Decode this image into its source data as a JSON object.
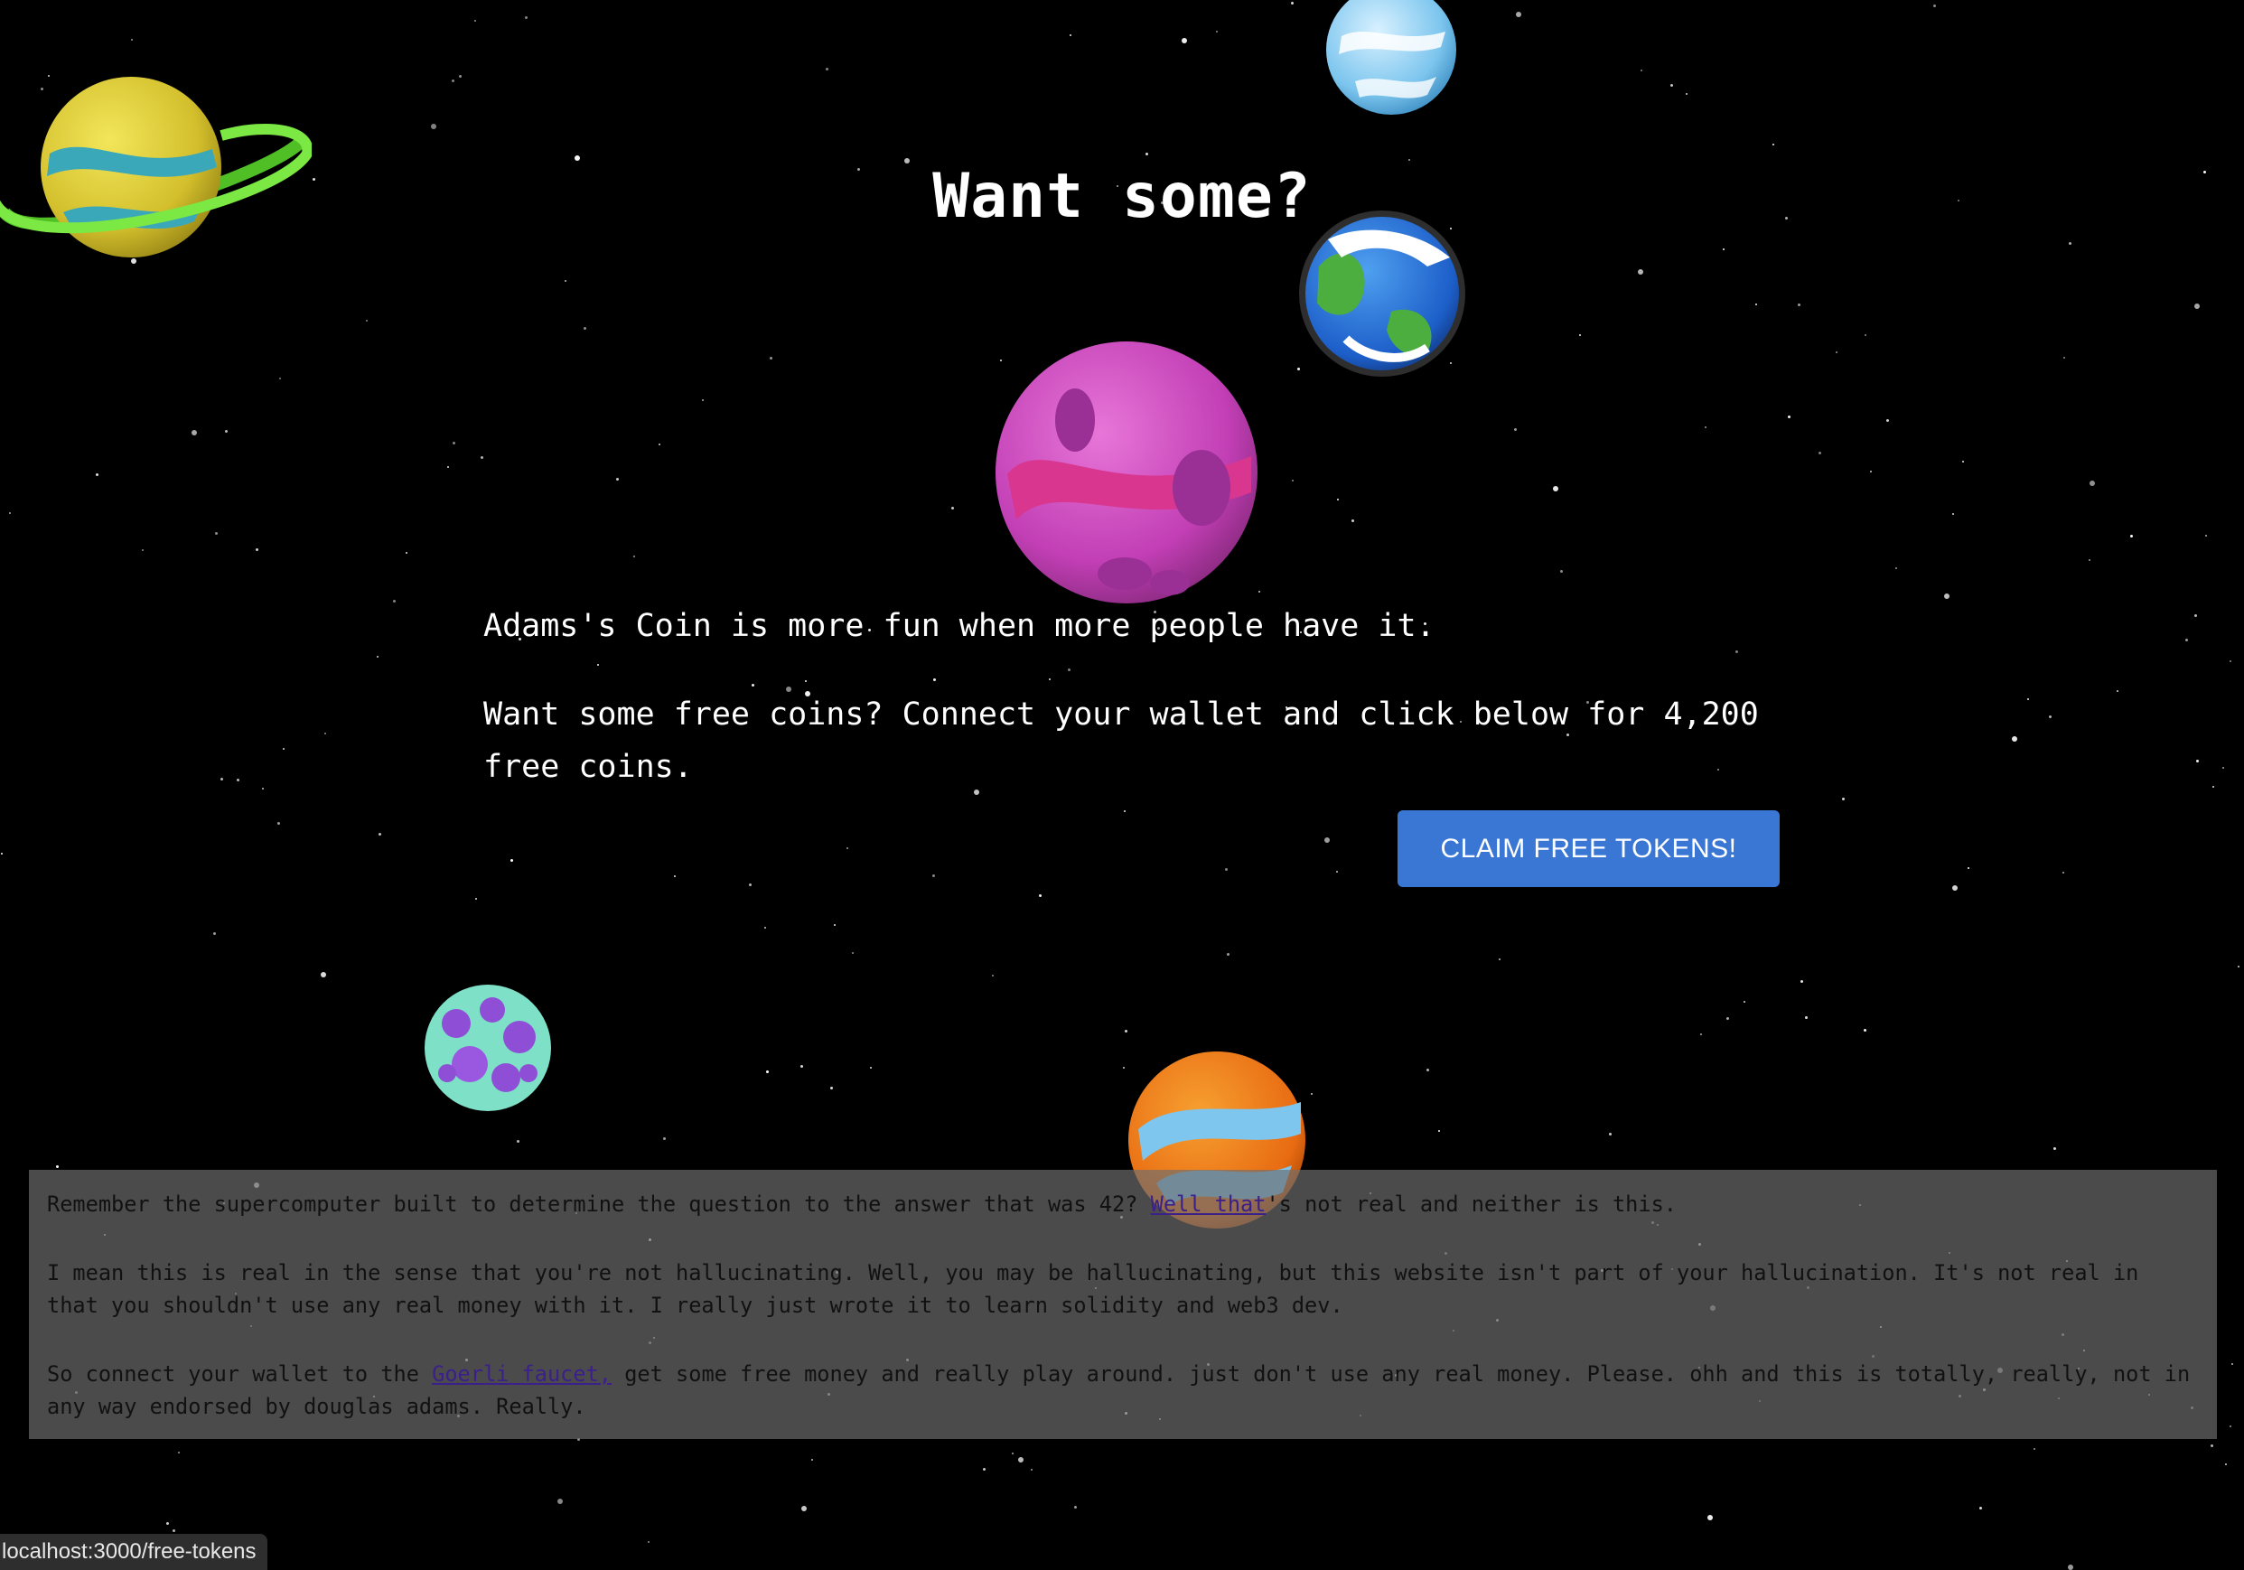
{
  "hero": {
    "title": "Want some?",
    "line1": "Adams's Coin is more fun when more people have it.",
    "line2": "Want some free coins? Connect your wallet and click below for 4,200 free coins.",
    "claim_label": "CLAIM FREE TOKENS!"
  },
  "disclaimer": {
    "p1_before": "Remember the supercomputer built to determine the question to the answer that was 42? ",
    "p1_link": "Well that",
    "p1_after": "'s not real and neither is this.",
    "p2": "I mean this is real in the sense that you're not hallucinating. Well, you may be hallucinating, but this website isn't part of your hallucination. It's not real in that you shouldn't use any real money with it. I really just wrote it to learn solidity and web3 dev.",
    "p3_before": "So connect your wallet to the ",
    "p3_link": "Goerli faucet,",
    "p3_after": " get some free money and really play around. just don't use any real money. Please. ohh and this is totally, really, not in any way endorsed by douglas adams. Really."
  },
  "status_bar": {
    "url": "localhost:3000/free-tokens"
  },
  "colors": {
    "background": "#000000",
    "button": "#3a77d4",
    "disclaimer_bg": "rgba(110,110,110,0.68)"
  },
  "icons": [
    "ringed-yellow-planet-icon",
    "ice-planet-icon",
    "earth-planet-icon",
    "pink-planet-icon",
    "purple-asteroid-planet-icon",
    "orange-swirl-planet-icon"
  ]
}
